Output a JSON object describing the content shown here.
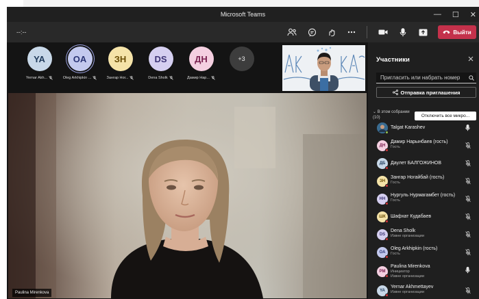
{
  "window": {
    "title": "Microsoft Teams",
    "controls": [
      "—",
      "☐",
      "✕"
    ]
  },
  "toolbar": {
    "timer": "--:--",
    "leave_label": "Выйти"
  },
  "colors": {
    "leave": "#c4314b",
    "panel_bg": "#1f1f1f",
    "stage_bg": "#141414",
    "status_busy": "#d13438",
    "status_available": "#92c353"
  },
  "avatars": [
    {
      "initials": "YA",
      "name": "Yernar Akh...",
      "bg": "#c8d8e8",
      "fg": "#1f3a5a"
    },
    {
      "initials": "OA",
      "name": "Oleg Arkhipkin ...",
      "bg": "#c3c9ee",
      "fg": "#2a3474"
    },
    {
      "initials": "ЗН",
      "name": "Зангар Ног...",
      "bg": "#f5e3a8",
      "fg": "#6a4e06"
    },
    {
      "initials": "DS",
      "name": "Dena Sholk",
      "bg": "#d5cff0",
      "fg": "#3d3475"
    },
    {
      "initials": "ДН",
      "name": "Дамир Нар...",
      "bg": "#f4cfe0",
      "fg": "#7a2150"
    }
  ],
  "more_count": "+3",
  "main_video": {
    "name": "Paulina Mirenkova"
  },
  "panel": {
    "title": "Участники",
    "search_placeholder": "Пригласить или набрать номер",
    "share_label": "Отправка приглашения",
    "section_label": "В этом собрании (10)",
    "mute_all_label": "Отключить все микро..."
  },
  "participants": [
    {
      "initials": "",
      "photo": true,
      "name": "Talgat Karashev",
      "sub": "",
      "mic": "on",
      "status": "available",
      "bg": "#3a6b8f",
      "fg": "#fff"
    },
    {
      "initials": "ДН",
      "name": "Дамир Нарынбаев (гость)",
      "sub": "Гость",
      "mic": "off",
      "status": "busy",
      "bg": "#f4cfe0",
      "fg": "#7a2150"
    },
    {
      "initials": "ДБ",
      "name": "Даулет БАЛГОЖИНОВ",
      "sub": "",
      "mic": "off",
      "status": "busy",
      "bg": "#c8d8e8",
      "fg": "#1f3a5a"
    },
    {
      "initials": "ЗН",
      "name": "Зангар Ногайбай (гость)",
      "sub": "Гость",
      "mic": "off",
      "status": "busy",
      "bg": "#f5e3a8",
      "fg": "#6a4e06"
    },
    {
      "initials": "НН",
      "name": "Нургуль Нурмагамбет (гость)",
      "sub": "Гость",
      "mic": "off",
      "status": "busy",
      "bg": "#d5cff0",
      "fg": "#3d3475"
    },
    {
      "initials": "ШК",
      "name": "Шафхат Кудабаев",
      "sub": "",
      "mic": "off",
      "status": "busy",
      "bg": "#f5e3a8",
      "fg": "#6a4e06"
    },
    {
      "initials": "DS",
      "name": "Dena Sholk",
      "sub": "Извне организации",
      "mic": "off",
      "status": "busy",
      "bg": "#d5cff0",
      "fg": "#3d3475"
    },
    {
      "initials": "OA",
      "name": "Oleg Arkhipkin (гость)",
      "sub": "Гость",
      "mic": "off",
      "status": "busy",
      "bg": "#c3c9ee",
      "fg": "#2a3474"
    },
    {
      "initials": "PM",
      "name": "Paulina Mirenkova",
      "sub": "Инициатор\nИзвне организации",
      "mic": "on",
      "status": "busy",
      "bg": "#f4cfe0",
      "fg": "#7a2150"
    },
    {
      "initials": "YA",
      "name": "Yernar Akhmettayev",
      "sub": "Извне организации",
      "mic": "off",
      "status": "busy",
      "bg": "#c8d8e8",
      "fg": "#1f3a5a"
    }
  ]
}
